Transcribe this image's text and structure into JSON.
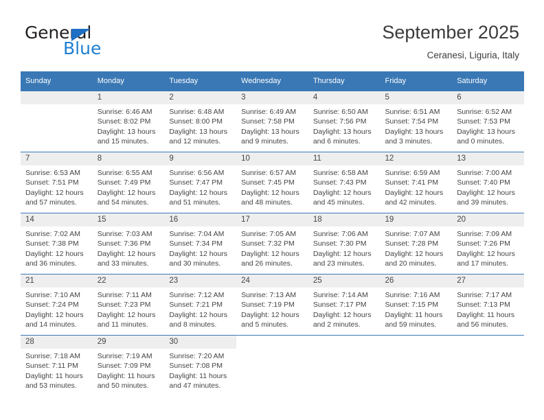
{
  "brand": {
    "name_dark": "General",
    "name_blue": "Blue",
    "accent_color": "#1f7fd0",
    "triangle_color": "#1f6fc4"
  },
  "header": {
    "title": "September 2025",
    "subtitle": "Ceranesi, Liguria, Italy"
  },
  "calendar": {
    "header_bg": "#3a78b5",
    "daynum_bg": "#eeeeee",
    "weekdays": [
      "Sunday",
      "Monday",
      "Tuesday",
      "Wednesday",
      "Thursday",
      "Friday",
      "Saturday"
    ],
    "weeks": [
      [
        {
          "day": "",
          "lines": []
        },
        {
          "day": "1",
          "lines": [
            "Sunrise: 6:46 AM",
            "Sunset: 8:02 PM",
            "Daylight: 13 hours",
            "and 15 minutes."
          ]
        },
        {
          "day": "2",
          "lines": [
            "Sunrise: 6:48 AM",
            "Sunset: 8:00 PM",
            "Daylight: 13 hours",
            "and 12 minutes."
          ]
        },
        {
          "day": "3",
          "lines": [
            "Sunrise: 6:49 AM",
            "Sunset: 7:58 PM",
            "Daylight: 13 hours",
            "and 9 minutes."
          ]
        },
        {
          "day": "4",
          "lines": [
            "Sunrise: 6:50 AM",
            "Sunset: 7:56 PM",
            "Daylight: 13 hours",
            "and 6 minutes."
          ]
        },
        {
          "day": "5",
          "lines": [
            "Sunrise: 6:51 AM",
            "Sunset: 7:54 PM",
            "Daylight: 13 hours",
            "and 3 minutes."
          ]
        },
        {
          "day": "6",
          "lines": [
            "Sunrise: 6:52 AM",
            "Sunset: 7:53 PM",
            "Daylight: 13 hours",
            "and 0 minutes."
          ]
        }
      ],
      [
        {
          "day": "7",
          "lines": [
            "Sunrise: 6:53 AM",
            "Sunset: 7:51 PM",
            "Daylight: 12 hours",
            "and 57 minutes."
          ]
        },
        {
          "day": "8",
          "lines": [
            "Sunrise: 6:55 AM",
            "Sunset: 7:49 PM",
            "Daylight: 12 hours",
            "and 54 minutes."
          ]
        },
        {
          "day": "9",
          "lines": [
            "Sunrise: 6:56 AM",
            "Sunset: 7:47 PM",
            "Daylight: 12 hours",
            "and 51 minutes."
          ]
        },
        {
          "day": "10",
          "lines": [
            "Sunrise: 6:57 AM",
            "Sunset: 7:45 PM",
            "Daylight: 12 hours",
            "and 48 minutes."
          ]
        },
        {
          "day": "11",
          "lines": [
            "Sunrise: 6:58 AM",
            "Sunset: 7:43 PM",
            "Daylight: 12 hours",
            "and 45 minutes."
          ]
        },
        {
          "day": "12",
          "lines": [
            "Sunrise: 6:59 AM",
            "Sunset: 7:41 PM",
            "Daylight: 12 hours",
            "and 42 minutes."
          ]
        },
        {
          "day": "13",
          "lines": [
            "Sunrise: 7:00 AM",
            "Sunset: 7:40 PM",
            "Daylight: 12 hours",
            "and 39 minutes."
          ]
        }
      ],
      [
        {
          "day": "14",
          "lines": [
            "Sunrise: 7:02 AM",
            "Sunset: 7:38 PM",
            "Daylight: 12 hours",
            "and 36 minutes."
          ]
        },
        {
          "day": "15",
          "lines": [
            "Sunrise: 7:03 AM",
            "Sunset: 7:36 PM",
            "Daylight: 12 hours",
            "and 33 minutes."
          ]
        },
        {
          "day": "16",
          "lines": [
            "Sunrise: 7:04 AM",
            "Sunset: 7:34 PM",
            "Daylight: 12 hours",
            "and 30 minutes."
          ]
        },
        {
          "day": "17",
          "lines": [
            "Sunrise: 7:05 AM",
            "Sunset: 7:32 PM",
            "Daylight: 12 hours",
            "and 26 minutes."
          ]
        },
        {
          "day": "18",
          "lines": [
            "Sunrise: 7:06 AM",
            "Sunset: 7:30 PM",
            "Daylight: 12 hours",
            "and 23 minutes."
          ]
        },
        {
          "day": "19",
          "lines": [
            "Sunrise: 7:07 AM",
            "Sunset: 7:28 PM",
            "Daylight: 12 hours",
            "and 20 minutes."
          ]
        },
        {
          "day": "20",
          "lines": [
            "Sunrise: 7:09 AM",
            "Sunset: 7:26 PM",
            "Daylight: 12 hours",
            "and 17 minutes."
          ]
        }
      ],
      [
        {
          "day": "21",
          "lines": [
            "Sunrise: 7:10 AM",
            "Sunset: 7:24 PM",
            "Daylight: 12 hours",
            "and 14 minutes."
          ]
        },
        {
          "day": "22",
          "lines": [
            "Sunrise: 7:11 AM",
            "Sunset: 7:23 PM",
            "Daylight: 12 hours",
            "and 11 minutes."
          ]
        },
        {
          "day": "23",
          "lines": [
            "Sunrise: 7:12 AM",
            "Sunset: 7:21 PM",
            "Daylight: 12 hours",
            "and 8 minutes."
          ]
        },
        {
          "day": "24",
          "lines": [
            "Sunrise: 7:13 AM",
            "Sunset: 7:19 PM",
            "Daylight: 12 hours",
            "and 5 minutes."
          ]
        },
        {
          "day": "25",
          "lines": [
            "Sunrise: 7:14 AM",
            "Sunset: 7:17 PM",
            "Daylight: 12 hours",
            "and 2 minutes."
          ]
        },
        {
          "day": "26",
          "lines": [
            "Sunrise: 7:16 AM",
            "Sunset: 7:15 PM",
            "Daylight: 11 hours",
            "and 59 minutes."
          ]
        },
        {
          "day": "27",
          "lines": [
            "Sunrise: 7:17 AM",
            "Sunset: 7:13 PM",
            "Daylight: 11 hours",
            "and 56 minutes."
          ]
        }
      ],
      [
        {
          "day": "28",
          "lines": [
            "Sunrise: 7:18 AM",
            "Sunset: 7:11 PM",
            "Daylight: 11 hours",
            "and 53 minutes."
          ]
        },
        {
          "day": "29",
          "lines": [
            "Sunrise: 7:19 AM",
            "Sunset: 7:09 PM",
            "Daylight: 11 hours",
            "and 50 minutes."
          ]
        },
        {
          "day": "30",
          "lines": [
            "Sunrise: 7:20 AM",
            "Sunset: 7:08 PM",
            "Daylight: 11 hours",
            "and 47 minutes."
          ]
        },
        {
          "day": "",
          "lines": []
        },
        {
          "day": "",
          "lines": []
        },
        {
          "day": "",
          "lines": []
        },
        {
          "day": "",
          "lines": []
        }
      ]
    ]
  }
}
